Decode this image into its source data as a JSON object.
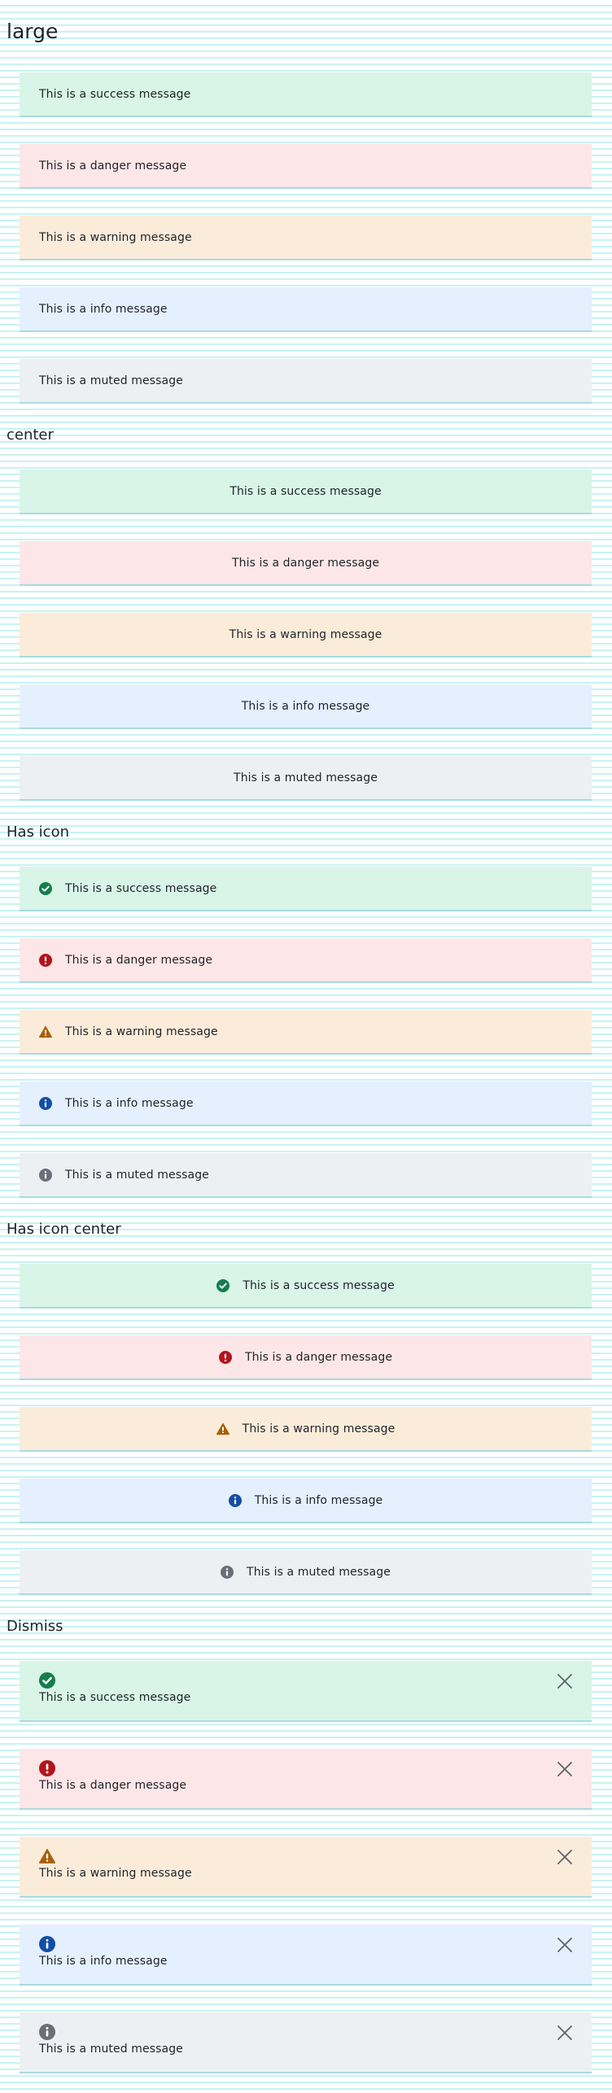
{
  "sections": {
    "large": "large",
    "center": "center",
    "has_icon": "Has icon",
    "has_icon_center": "Has icon center",
    "dismiss": "Dismiss"
  },
  "messages": {
    "success": "This is a success message",
    "danger": "This is a danger message",
    "warning": "This is a warning message",
    "info": "This is a info message",
    "muted": "This is a muted message"
  },
  "icons": {
    "success": "check-circle-icon",
    "danger": "exclamation-circle-icon",
    "warning": "warning-triangle-icon",
    "info": "info-circle-icon",
    "muted": "info-circle-icon",
    "dismiss": "close-icon"
  },
  "colors": {
    "success_bg": "#d8f5e7",
    "success_icon": "#157d4e",
    "danger_bg": "#fde6e7",
    "danger_icon": "#b2151c",
    "warning_bg": "#fbecda",
    "warning_icon": "#a85f0a",
    "info_bg": "#e5f0fe",
    "info_icon": "#134ea6",
    "muted_bg": "#edf0f2",
    "muted_icon": "#6b6f76",
    "alert_border": "#a7dbe0"
  }
}
